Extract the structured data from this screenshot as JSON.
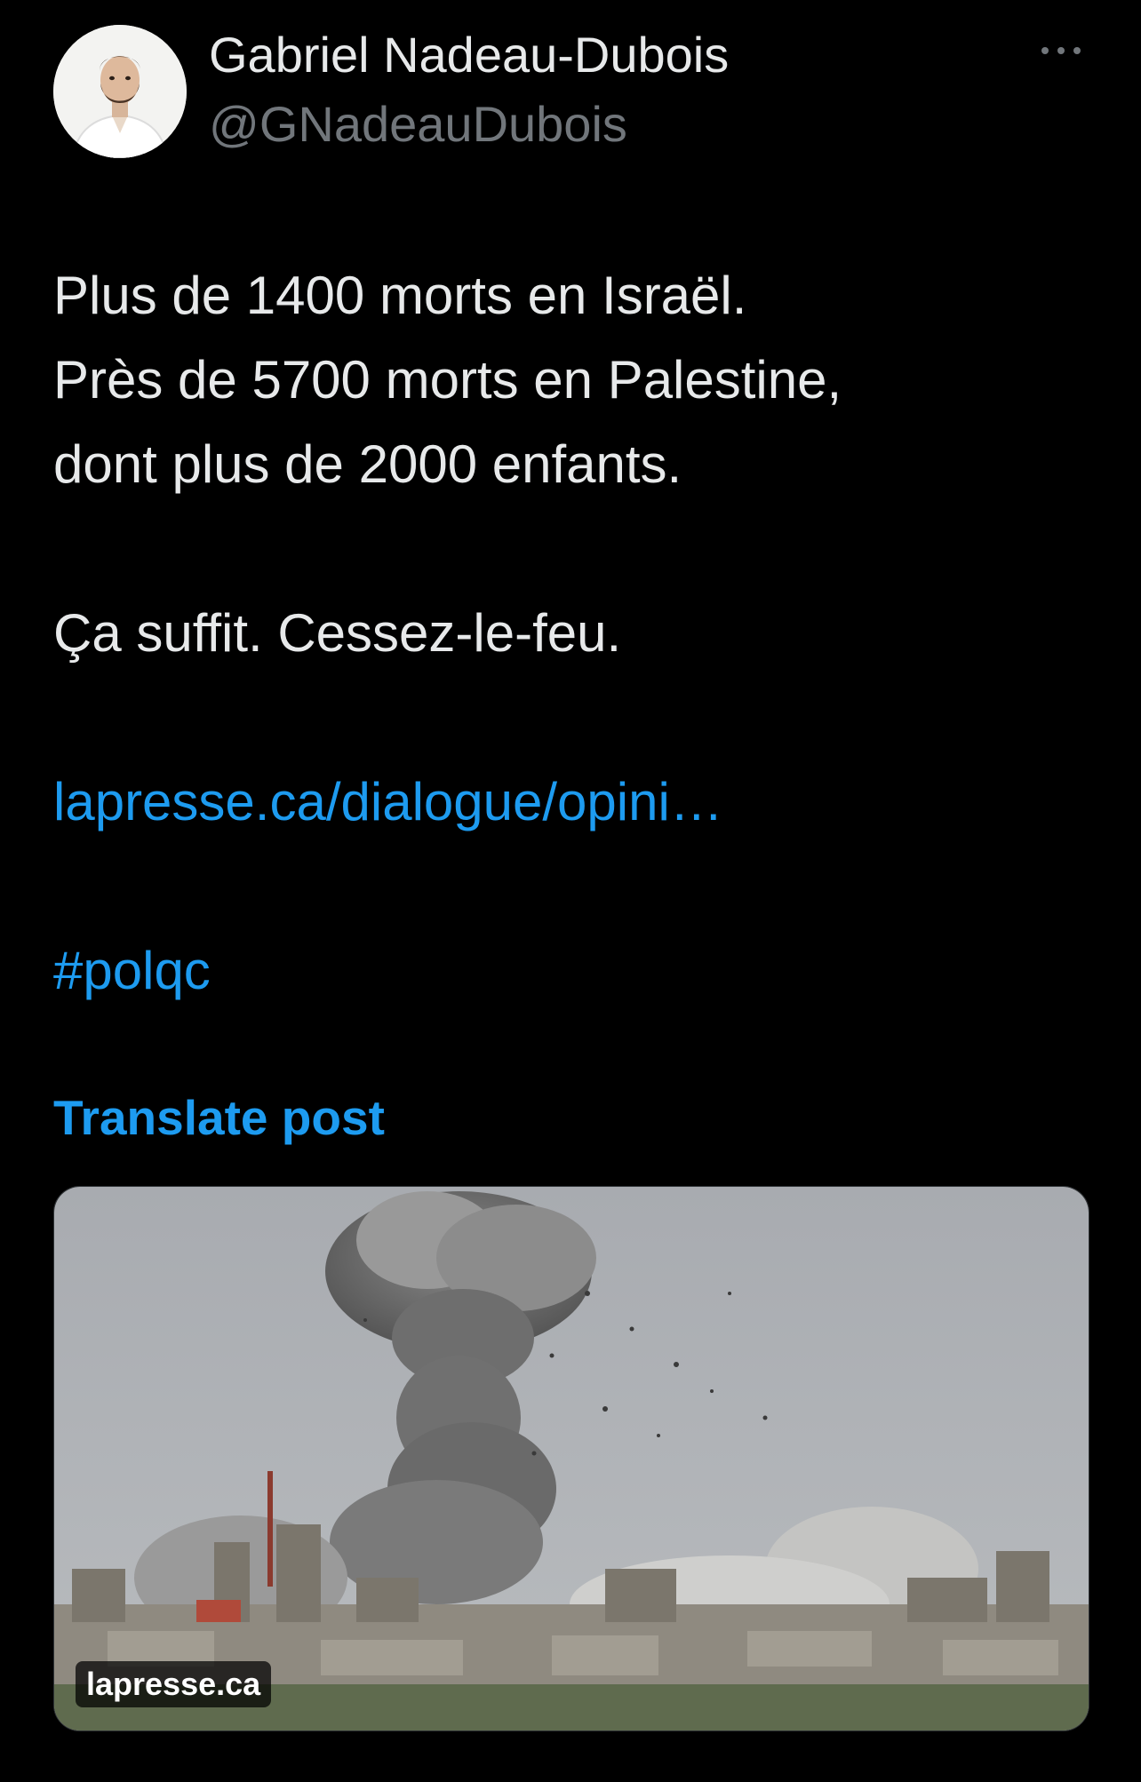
{
  "author": {
    "display_name": "Gabriel Nadeau-Dubois",
    "handle": "@GNadeauDubois",
    "avatar_icon": "profile-photo"
  },
  "more_icon": "ellipsis-icon",
  "post": {
    "line1": "Plus de 1400 morts en Israël.",
    "line2": "Près de 5700 morts en Palestine,",
    "line3": "dont plus de 2000 enfants.",
    "line4": "Ça suffit. Cessez-le-feu.",
    "link": "lapresse.ca/dialogue/opini…",
    "hashtag": "#polqc"
  },
  "translate_label": "Translate post",
  "card": {
    "domain": "lapresse.ca"
  },
  "colors": {
    "background": "#000000",
    "text": "#e7e9ea",
    "secondary": "#71767b",
    "accent": "#1d9bf0"
  }
}
